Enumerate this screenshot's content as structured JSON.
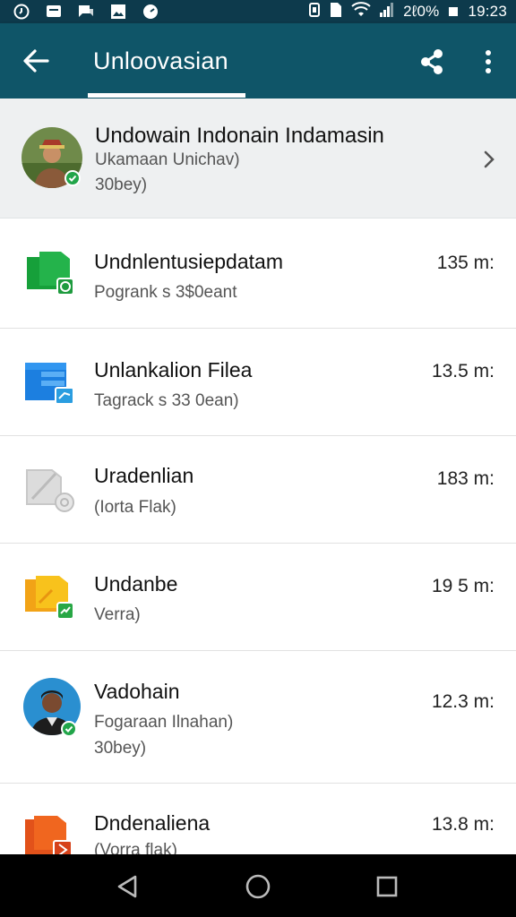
{
  "status_bar": {
    "battery_text": "2ℓ0%",
    "time": "19:23"
  },
  "toolbar": {
    "title": "Unloovasian"
  },
  "contact": {
    "name": "Undowain Indonain Indamasin",
    "line1": "Ukamaan Unichav)",
    "line2": "30bey)"
  },
  "items": [
    {
      "title": "Undnlentusiepdatam",
      "subtitle": "Pogrank s 3$0eant",
      "size": "135 m:",
      "icon": "green-file-icon"
    },
    {
      "title": "Unlankalion Filea",
      "subtitle": "Tagrack s 33 0ean)",
      "size": "13.5 m:",
      "icon": "blue-file-icon"
    },
    {
      "title": "Uradenlian",
      "subtitle": "(Iorta Flak)",
      "size": "183 m:",
      "icon": "gray-file-icon"
    },
    {
      "title": "Undanbe",
      "subtitle": "Verra)",
      "size": "19 5 m:",
      "icon": "yellow-file-icon"
    },
    {
      "title": "Vadohain",
      "subtitle": "Fogaraan Ilnahan)",
      "subtitle2": "30bey)",
      "size": "12.3 m:",
      "icon": "person-avatar"
    },
    {
      "title": "Dndenaliena",
      "subtitle": "(Vorra flak)",
      "size": "13.8 m:",
      "icon": "orange-file-icon"
    }
  ],
  "colors": {
    "toolbar": "#0f5568",
    "status_bar": "#0d3a4c",
    "check_badge": "#22a54a"
  }
}
